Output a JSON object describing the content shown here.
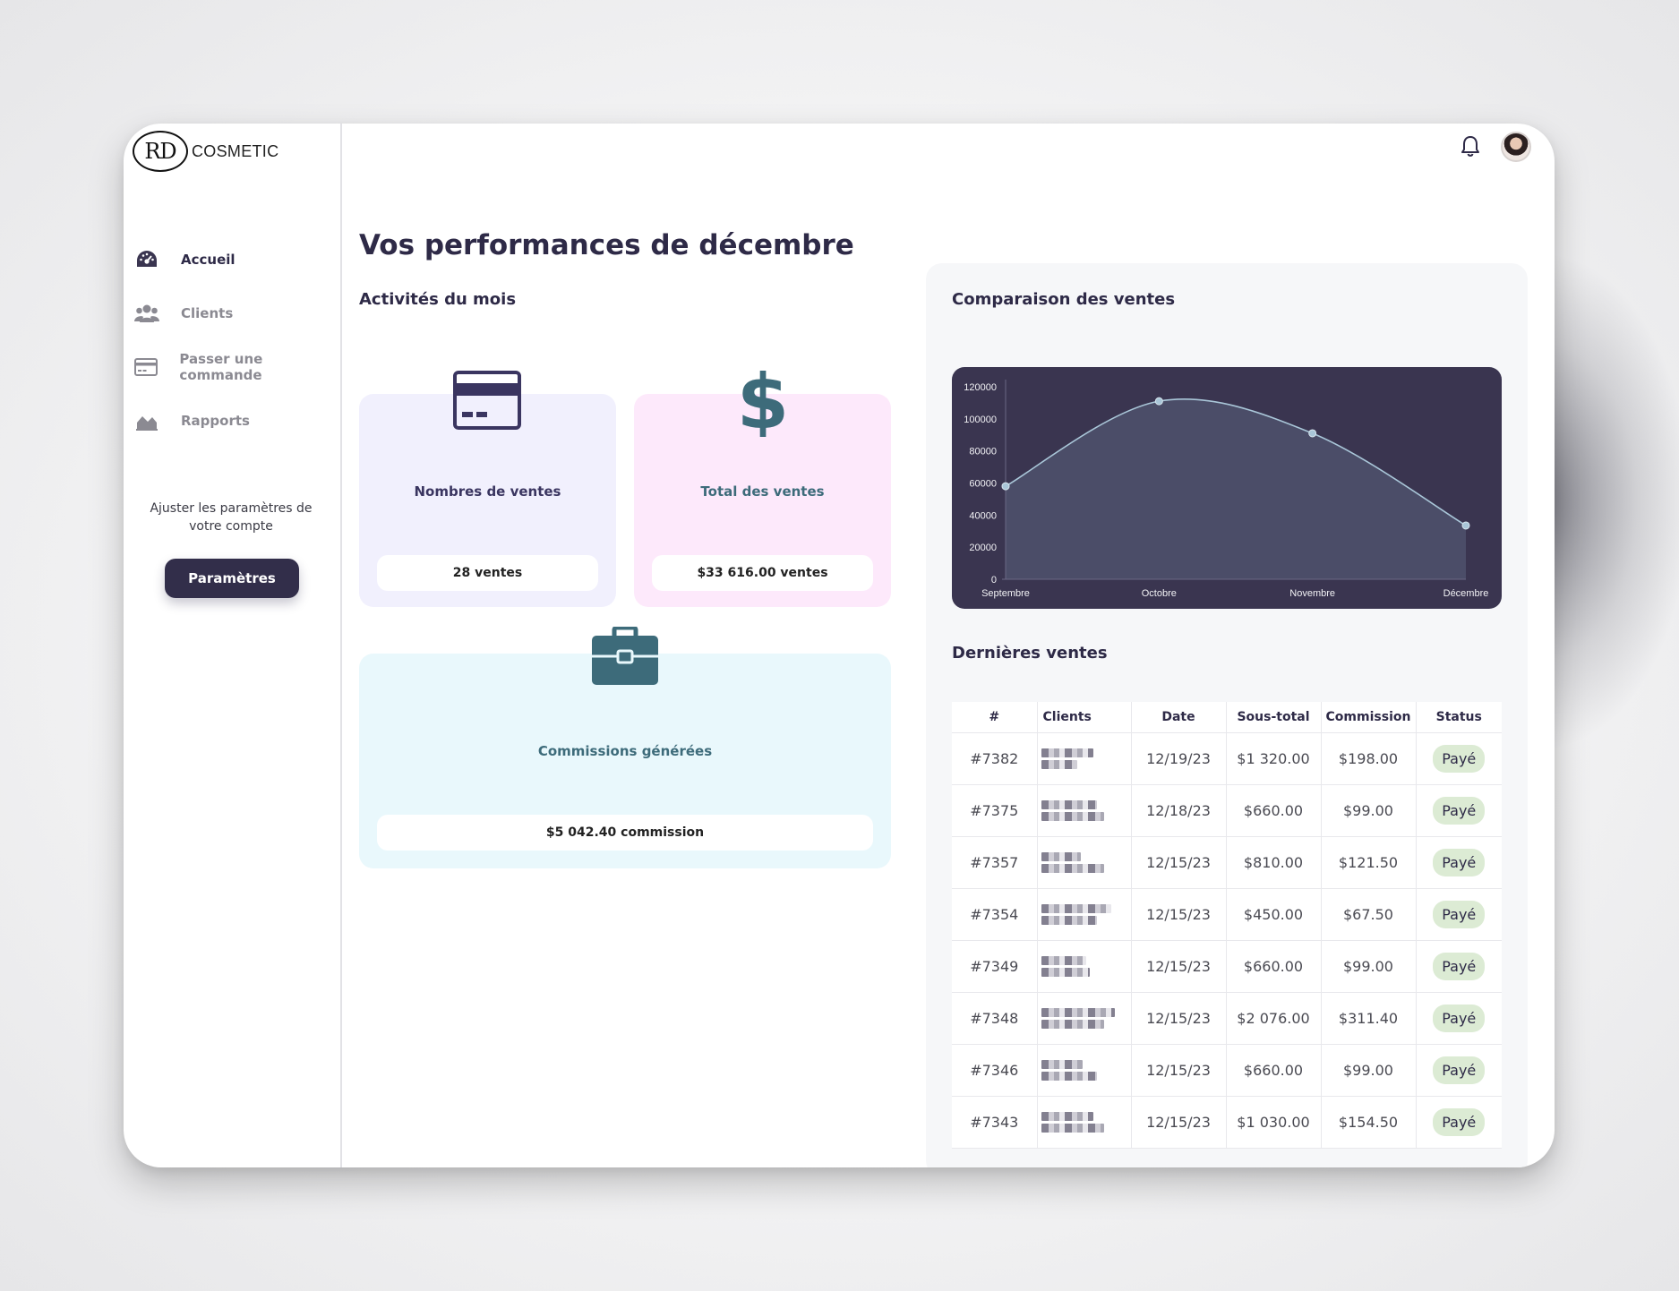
{
  "brand": {
    "logo_mark": "RD",
    "logo_text": "COSMETIC"
  },
  "sidebar": {
    "items": [
      {
        "label": "Accueil",
        "icon": "dashboard-icon",
        "active": true
      },
      {
        "label": "Clients",
        "icon": "users-icon",
        "active": false
      },
      {
        "label": "Passer une commande",
        "icon": "credit-card-icon",
        "active": false
      },
      {
        "label": "Rapports",
        "icon": "area-chart-icon",
        "active": false
      }
    ],
    "settings_note": "Ajuster les paramètres de votre compte",
    "settings_button": "Paramètres"
  },
  "header": {
    "notification_icon": "bell-icon",
    "avatar": "user-avatar"
  },
  "main": {
    "title": "Vos performances de décembre",
    "activities_title": "Activités du mois",
    "cards": [
      {
        "icon": "credit-card-icon",
        "label": "Nombres de ventes",
        "value": "28 ventes",
        "bg": "#f1f0fd",
        "label_color": "#3a3560"
      },
      {
        "icon": "dollar-icon",
        "label": "Total des ventes",
        "value": "$33 616.00 ventes",
        "bg": "#fde9fb",
        "label_color": "#3d6b7a"
      },
      {
        "icon": "briefcase-icon",
        "label": "Commissions générées",
        "value": "$5 042.40 commission",
        "bg": "#e9f8fc",
        "label_color": "#3d6b7a"
      }
    ]
  },
  "right": {
    "chart_title": "Comparaison des ventes",
    "sales_title": "Dernières ventes",
    "table": {
      "headers": [
        "#",
        "Clients",
        "Date",
        "Sous-total",
        "Commission",
        "Status"
      ],
      "rows": [
        {
          "id": "#7382",
          "date": "12/19/23",
          "subtotal": "$1 320.00",
          "commission": "$198.00",
          "status": "Payé"
        },
        {
          "id": "#7375",
          "date": "12/18/23",
          "subtotal": "$660.00",
          "commission": "$99.00",
          "status": "Payé"
        },
        {
          "id": "#7357",
          "date": "12/15/23",
          "subtotal": "$810.00",
          "commission": "$121.50",
          "status": "Payé"
        },
        {
          "id": "#7354",
          "date": "12/15/23",
          "subtotal": "$450.00",
          "commission": "$67.50",
          "status": "Payé"
        },
        {
          "id": "#7349",
          "date": "12/15/23",
          "subtotal": "$660.00",
          "commission": "$99.00",
          "status": "Payé"
        },
        {
          "id": "#7348",
          "date": "12/15/23",
          "subtotal": "$2 076.00",
          "commission": "$311.40",
          "status": "Payé"
        },
        {
          "id": "#7346",
          "date": "12/15/23",
          "subtotal": "$660.00",
          "commission": "$99.00",
          "status": "Payé"
        },
        {
          "id": "#7343",
          "date": "12/15/23",
          "subtotal": "$1 030.00",
          "commission": "$154.50",
          "status": "Payé"
        }
      ]
    }
  },
  "colors": {
    "primary": "#322e4a",
    "chart_bg": "#3a3550",
    "chart_fill": "#4b4d68",
    "chart_line": "#a9c6d8",
    "teal": "#3d6b7a",
    "paid_badge": "#dcebd4"
  },
  "chart_data": {
    "type": "area",
    "title": "Comparaison des ventes",
    "categories": [
      "Septembre",
      "Octobre",
      "Novembre",
      "Décembre"
    ],
    "series": [
      {
        "values": [
          58000,
          111000,
          91000,
          33500
        ]
      }
    ],
    "ylim": [
      0,
      120000
    ],
    "yticks": [
      0,
      20000,
      40000,
      60000,
      80000,
      100000,
      120000
    ],
    "grid": false
  }
}
